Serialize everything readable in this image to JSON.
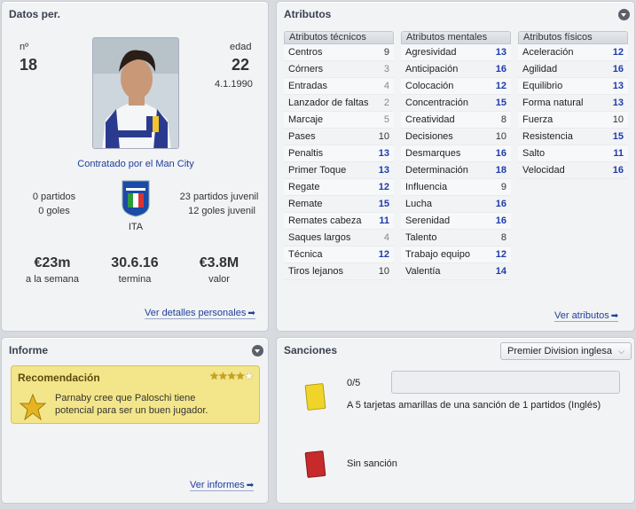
{
  "personal": {
    "title": "Datos per.",
    "number_label": "nº",
    "number": "18",
    "age_label": "edad",
    "age": "22",
    "dob": "4.1.1990",
    "contract_note": "Contratado por el Man City",
    "senior_apps": "0 partidos",
    "senior_goals": "0 goles",
    "youth_apps": "23 partidos juvenil",
    "youth_goals": "12 goles juvenil",
    "nation": "ITA",
    "wage": "€23m",
    "wage_label": "a la semana",
    "expires": "30.6.16",
    "expires_label": "termina",
    "value": "€3.8M",
    "value_label": "valor",
    "details_link": "Ver detalles personales"
  },
  "attributes": {
    "title": "Atributos",
    "link": "Ver atributos",
    "technical": {
      "header": "Atributos técnicos",
      "rows": [
        {
          "name": "Centros",
          "value": "9"
        },
        {
          "name": "Córners",
          "value": "3"
        },
        {
          "name": "Entradas",
          "value": "4"
        },
        {
          "name": "Lanzador de faltas",
          "value": "2"
        },
        {
          "name": "Marcaje",
          "value": "5"
        },
        {
          "name": "Pases",
          "value": "10"
        },
        {
          "name": "Penaltis",
          "value": "13"
        },
        {
          "name": "Primer Toque",
          "value": "13"
        },
        {
          "name": "Regate",
          "value": "12"
        },
        {
          "name": "Remate",
          "value": "15"
        },
        {
          "name": "Remates cabeza",
          "value": "11"
        },
        {
          "name": "Saques largos",
          "value": "4"
        },
        {
          "name": "Técnica",
          "value": "12"
        },
        {
          "name": "Tiros lejanos",
          "value": "10"
        }
      ]
    },
    "mental": {
      "header": "Atributos mentales",
      "rows": [
        {
          "name": "Agresividad",
          "value": "13"
        },
        {
          "name": "Anticipación",
          "value": "16"
        },
        {
          "name": "Colocación",
          "value": "12"
        },
        {
          "name": "Concentración",
          "value": "15"
        },
        {
          "name": "Creatividad",
          "value": "8"
        },
        {
          "name": "Decisiones",
          "value": "10"
        },
        {
          "name": "Desmarques",
          "value": "16"
        },
        {
          "name": "Determinación",
          "value": "18"
        },
        {
          "name": "Influencia",
          "value": "9"
        },
        {
          "name": "Lucha",
          "value": "16"
        },
        {
          "name": "Serenidad",
          "value": "16"
        },
        {
          "name": "Talento",
          "value": "8"
        },
        {
          "name": "Trabajo equipo",
          "value": "12"
        },
        {
          "name": "Valentía",
          "value": "14"
        }
      ]
    },
    "physical": {
      "header": "Atributos físicos",
      "rows": [
        {
          "name": "Aceleración",
          "value": "12"
        },
        {
          "name": "Agilidad",
          "value": "16"
        },
        {
          "name": "Equilibrio",
          "value": "13"
        },
        {
          "name": "Forma natural",
          "value": "13"
        },
        {
          "name": "Fuerza",
          "value": "10"
        },
        {
          "name": "Resistencia",
          "value": "15"
        },
        {
          "name": "Salto",
          "value": "11"
        },
        {
          "name": "Velocidad",
          "value": "16"
        }
      ]
    }
  },
  "report": {
    "title": "Informe",
    "rec_title": "Recomendación",
    "rec_stars": 4,
    "rec_stars_max": 5,
    "rec_text": "Parnaby cree que Paloschi tiene potencial para ser un buen jugador.",
    "link": "Ver informes"
  },
  "sanctions": {
    "title": "Sanciones",
    "competition": "Premier Division inglesa",
    "yellow_count": "0/5",
    "yellow_progress": 0,
    "yellow_text": "A 5 tarjetas amarillas de una sanción de 1 partidos (Inglés)",
    "red_text": "Sin sanción"
  },
  "colors": {
    "low": "#888888",
    "mid": "#333333",
    "high": "#1e3cab",
    "yellow_card": "#f0d42a",
    "red_card": "#c62a2a"
  },
  "icons": [
    "collapse-icon",
    "arrow-right-icon",
    "star-icon",
    "flag-icon",
    "chevron-down-icon"
  ]
}
